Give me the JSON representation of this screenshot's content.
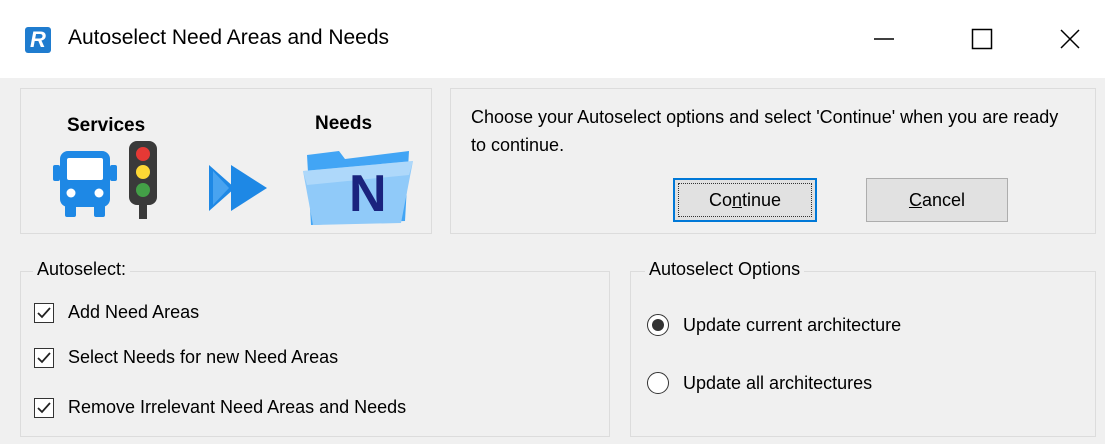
{
  "window": {
    "title": "Autoselect Need Areas and Needs",
    "app_icon_letter": "R"
  },
  "banner": {
    "services_label": "Services",
    "needs_label": "Needs",
    "needs_icon_letter": "N"
  },
  "prompt": {
    "text": "Choose your Autoselect options and select 'Continue' when you are ready to continue."
  },
  "buttons": {
    "continue_pre": "Co",
    "continue_key": "n",
    "continue_post": "tinue",
    "cancel_key": "C",
    "cancel_post": "ancel"
  },
  "autoselect": {
    "legend": "Autoselect:",
    "items": [
      {
        "label": "Add Need Areas",
        "checked": true
      },
      {
        "label": "Select Needs for new Need Areas",
        "checked": true
      },
      {
        "label": "Remove Irrelevant Need Areas and Needs",
        "checked": true
      }
    ]
  },
  "options": {
    "legend": "Autoselect Options",
    "items": [
      {
        "label": "Update current architecture",
        "selected": true
      },
      {
        "label": "Update all architectures",
        "selected": false
      }
    ]
  },
  "colors": {
    "accent": "#0078d7",
    "bus_blue": "#1e88e5",
    "arrow_blue": "#1e88e5",
    "window_bg": "#f0f0f0"
  }
}
